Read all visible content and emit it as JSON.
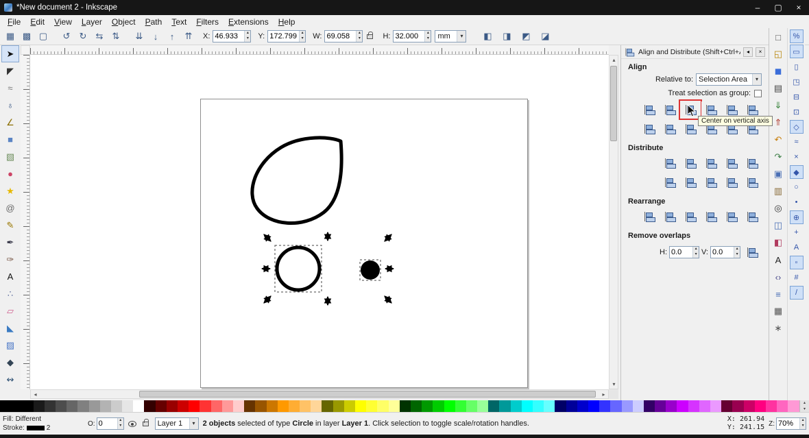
{
  "titlebar": {
    "title": "*New document 2 - Inkscape",
    "minimize": "–",
    "maximize": "▢",
    "close": "×"
  },
  "menubar": {
    "items": [
      {
        "name": "menu-file",
        "label": "File"
      },
      {
        "name": "menu-edit",
        "label": "Edit"
      },
      {
        "name": "menu-view",
        "label": "View"
      },
      {
        "name": "menu-layer",
        "label": "Layer"
      },
      {
        "name": "menu-object",
        "label": "Object"
      },
      {
        "name": "menu-path",
        "label": "Path"
      },
      {
        "name": "menu-text",
        "label": "Text"
      },
      {
        "name": "menu-filters",
        "label": "Filters"
      },
      {
        "name": "menu-extensions",
        "label": "Extensions"
      },
      {
        "name": "menu-help",
        "label": "Help"
      }
    ]
  },
  "toolbar": {
    "left_icons": [
      {
        "name": "select-all-icon",
        "glyph": "▦"
      },
      {
        "name": "select-all-layers-icon",
        "glyph": "▩"
      },
      {
        "name": "deselect-icon",
        "glyph": "▢"
      },
      {
        "name": "separator",
        "glyph": "",
        "sep": true
      },
      {
        "name": "rotate-ccw-icon",
        "glyph": "↺"
      },
      {
        "name": "rotate-cw-icon",
        "glyph": "↻"
      },
      {
        "name": "flip-horizontal-icon",
        "glyph": "⇆"
      },
      {
        "name": "flip-vertical-icon",
        "glyph": "⇅"
      },
      {
        "name": "separator",
        "glyph": "",
        "sep": true
      },
      {
        "name": "lower-to-bottom-icon",
        "glyph": "⇊"
      },
      {
        "name": "lower-icon",
        "glyph": "↓"
      },
      {
        "name": "raise-icon",
        "glyph": "↑"
      },
      {
        "name": "raise-to-top-icon",
        "glyph": "⇈"
      }
    ],
    "x_label": "X:",
    "x_value": "46.933",
    "y_label": "Y:",
    "y_value": "172.799",
    "w_label": "W:",
    "w_value": "69.058",
    "h_label": "H:",
    "h_value": "32.000",
    "units_value": "mm",
    "right_icons": [
      {
        "name": "transform-stroke-toggle-icon",
        "glyph": "◧"
      },
      {
        "name": "transform-corners-toggle-icon",
        "glyph": "◨"
      },
      {
        "name": "transform-gradient-toggle-icon",
        "glyph": "◩"
      },
      {
        "name": "transform-pattern-toggle-icon",
        "glyph": "◪"
      }
    ]
  },
  "toolbox": {
    "tools": [
      {
        "name": "selector-tool",
        "glyph": "➤",
        "color": "#111111",
        "selected": true
      },
      {
        "name": "node-editor-tool",
        "glyph": "◤",
        "color": "#333333"
      },
      {
        "name": "tweak-tool",
        "glyph": "≈",
        "color": "#777777"
      },
      {
        "name": "zoom-tool",
        "glyph": "♁",
        "color": "#2f4f7f"
      },
      {
        "name": "measure-tool",
        "glyph": "∠",
        "color": "#8a6d00"
      },
      {
        "name": "rectangle-tool",
        "glyph": "■",
        "color": "#5b84c4"
      },
      {
        "name": "box3d-tool",
        "glyph": "▧",
        "color": "#6f8f5f"
      },
      {
        "name": "ellipse-tool",
        "glyph": "●",
        "color": "#cc4466"
      },
      {
        "name": "star-tool",
        "glyph": "★",
        "color": "#e6b800"
      },
      {
        "name": "spiral-tool",
        "glyph": "@",
        "color": "#666666"
      },
      {
        "name": "pencil-tool",
        "glyph": "✎",
        "color": "#997700"
      },
      {
        "name": "pen-tool",
        "glyph": "✒",
        "color": "#333344"
      },
      {
        "name": "calligraphy-tool",
        "glyph": "✑",
        "color": "#775544"
      },
      {
        "name": "text-tool",
        "glyph": "A",
        "color": "#111111"
      },
      {
        "name": "spray-tool",
        "glyph": "∴",
        "color": "#556699"
      },
      {
        "name": "eraser-tool",
        "glyph": "▱",
        "color": "#d06090"
      },
      {
        "name": "paint-bucket-tool",
        "glyph": "◣",
        "color": "#3a7ac2"
      },
      {
        "name": "gradient-tool",
        "glyph": "▨",
        "color": "#4d79c7"
      },
      {
        "name": "dropper-tool",
        "glyph": "◆",
        "color": "#334455"
      },
      {
        "name": "connector-tool",
        "glyph": "↭",
        "color": "#335577"
      }
    ]
  },
  "align_panel": {
    "title": "Align and Distribute (Shift+Ctrl+A)",
    "align_header": "Align",
    "relative_to_label": "Relative to:",
    "relative_to_value": "Selection Area",
    "group_label": "Treat selection as group:",
    "align_row1": [
      {
        "name": "align-right-to-left-edge-button"
      },
      {
        "name": "align-left-edges-button"
      },
      {
        "name": "center-on-vertical-axis-button",
        "highlight": true
      },
      {
        "name": "align-right-edges-button"
      },
      {
        "name": "align-left-to-right-edge-button"
      },
      {
        "name": "text-align-horizontal-button"
      }
    ],
    "align_row2": [
      {
        "name": "align-bottom-to-top-edge-button"
      },
      {
        "name": "align-top-edges-button"
      },
      {
        "name": "center-on-horizontal-axis-button"
      },
      {
        "name": "align-bottom-edges-button"
      },
      {
        "name": "align-top-to-bottom-edge-button"
      },
      {
        "name": "text-baseline-button"
      }
    ],
    "distribute_header": "Distribute",
    "distribute_row1": [
      {
        "name": "distribute-left-edges-button"
      },
      {
        "name": "distribute-centers-horizontal-button"
      },
      {
        "name": "distribute-right-edges-button"
      },
      {
        "name": "distribute-equal-horizontal-gaps-button"
      },
      {
        "name": "distribute-text-anchors-horizontal-button"
      }
    ],
    "distribute_row2": [
      {
        "name": "distribute-top-edges-button"
      },
      {
        "name": "distribute-centers-vertical-button"
      },
      {
        "name": "distribute-bottom-edges-button"
      },
      {
        "name": "distribute-equal-vertical-gaps-button"
      },
      {
        "name": "distribute-text-baselines-vertical-button"
      }
    ],
    "rearrange_header": "Rearrange",
    "rearrange_row": [
      {
        "name": "graph-layout-button"
      },
      {
        "name": "exchange-selection-order-button"
      },
      {
        "name": "exchange-stacking-order-button"
      },
      {
        "name": "rotate-positions-button"
      },
      {
        "name": "randomize-centers-button"
      },
      {
        "name": "unclump-button"
      }
    ],
    "remove_header": "Remove overlaps",
    "h_label": "H:",
    "h_value": "0.0",
    "v_label": "V:",
    "v_value": "0.0",
    "tooltip": "Center on vertical axis"
  },
  "commands_bar": {
    "items": [
      {
        "name": "new-document-icon",
        "glyph": "□",
        "color": "#555555"
      },
      {
        "name": "open-document-icon",
        "glyph": "◱",
        "color": "#b8860b"
      },
      {
        "name": "save-icon",
        "glyph": "◼",
        "color": "#3a6dd9"
      },
      {
        "name": "print-icon",
        "glyph": "▤",
        "color": "#444444"
      },
      {
        "name": "import-icon",
        "glyph": "⇓",
        "color": "#2e7d32"
      },
      {
        "name": "export-icon",
        "glyph": "⇑",
        "color": "#b03a2e"
      },
      {
        "name": "undo-icon",
        "glyph": "↶",
        "color": "#c77d0a"
      },
      {
        "name": "redo-icon",
        "glyph": "↷",
        "color": "#3a7d44"
      },
      {
        "name": "copy-icon",
        "glyph": "▣",
        "color": "#4a6fb5"
      },
      {
        "name": "paste-icon",
        "glyph": "▥",
        "color": "#8a6d3b"
      },
      {
        "name": "zoom-drawing-icon",
        "glyph": "◎",
        "color": "#333333"
      },
      {
        "name": "duplicate-icon",
        "glyph": "◫",
        "color": "#4a6fb5"
      },
      {
        "name": "fill-stroke-dialog-icon",
        "glyph": "◧",
        "color": "#b03a5e"
      },
      {
        "name": "text-dialog-icon",
        "glyph": "A",
        "color": "#222222"
      },
      {
        "name": "xml-editor-icon",
        "glyph": "‹›",
        "color": "#4a4a8a"
      },
      {
        "name": "align-dialog-icon",
        "glyph": "≡",
        "color": "#4a6fb5"
      },
      {
        "name": "document-properties-icon",
        "glyph": "▦",
        "color": "#555555"
      },
      {
        "name": "preferences-icon",
        "glyph": "∗",
        "color": "#555555"
      }
    ]
  },
  "snap_bar": {
    "items": [
      {
        "name": "snap-toggle-icon",
        "glyph": "%",
        "active": true
      },
      {
        "name": "snap-bbox-icon",
        "glyph": "▭",
        "active": true
      },
      {
        "name": "snap-bbox-edges-icon",
        "glyph": "▯"
      },
      {
        "name": "snap-bbox-corners-icon",
        "glyph": "◳"
      },
      {
        "name": "snap-bbox-edge-midpoints-icon",
        "glyph": "⊟"
      },
      {
        "name": "snap-bbox-centers-icon",
        "glyph": "⊡"
      },
      {
        "name": "snap-nodes-icon",
        "glyph": "◇",
        "active": true
      },
      {
        "name": "snap-paths-icon",
        "glyph": "≈"
      },
      {
        "name": "snap-path-intersections-icon",
        "glyph": "×"
      },
      {
        "name": "snap-cusp-nodes-icon",
        "glyph": "◆",
        "active": true
      },
      {
        "name": "snap-smooth-nodes-icon",
        "glyph": "○"
      },
      {
        "name": "snap-midpoints-icon",
        "glyph": "•"
      },
      {
        "name": "snap-object-centers-icon",
        "glyph": "⊕",
        "active": true
      },
      {
        "name": "snap-rotation-centers-icon",
        "glyph": "+"
      },
      {
        "name": "snap-text-baseline-icon",
        "glyph": "A"
      },
      {
        "name": "snap-page-border-icon",
        "glyph": "▫",
        "active": true
      },
      {
        "name": "snap-grids-icon",
        "glyph": "#"
      },
      {
        "name": "snap-guides-icon",
        "glyph": "/",
        "active": true
      }
    ]
  },
  "palette": {
    "colors": [
      "#000000",
      "#1a1a1a",
      "#333333",
      "#4d4d4d",
      "#666666",
      "#808080",
      "#999999",
      "#b3b3b3",
      "#cccccc",
      "#e6e6e6",
      "#ffffff",
      "#330000",
      "#660000",
      "#990000",
      "#cc0000",
      "#ff0000",
      "#ff3333",
      "#ff6666",
      "#ff9999",
      "#ffcccc",
      "#663300",
      "#995500",
      "#cc7700",
      "#ff9900",
      "#ffad33",
      "#ffc266",
      "#ffd699",
      "#666600",
      "#999900",
      "#cccc00",
      "#ffff00",
      "#ffff33",
      "#ffff66",
      "#ffff99",
      "#003300",
      "#006600",
      "#009900",
      "#00cc00",
      "#00ff00",
      "#33ff33",
      "#66ff66",
      "#99ff99",
      "#006666",
      "#009999",
      "#00cccc",
      "#00ffff",
      "#33ffff",
      "#66ffff",
      "#000066",
      "#000099",
      "#0000cc",
      "#0000ff",
      "#3333ff",
      "#6666ff",
      "#9999ff",
      "#ccccff",
      "#330066",
      "#660099",
      "#9900cc",
      "#cc00ff",
      "#d633ff",
      "#e066ff",
      "#eb99ff",
      "#660033",
      "#990050",
      "#cc0066",
      "#ff0080",
      "#ff33a0",
      "#ff66c0",
      "#ff99d5"
    ]
  },
  "statusbar": {
    "fill_label": "Fill:",
    "fill_value": "Different",
    "stroke_label": "Stroke:",
    "stroke_width": "2",
    "opacity_label": "O:",
    "opacity_value": "0",
    "layer_name": "Layer 1",
    "message_parts": [
      {
        "text": "2 objects",
        "bold": true
      },
      {
        "text": " selected of type ",
        "bold": false
      },
      {
        "text": "Circle",
        "bold": true
      },
      {
        "text": " in layer ",
        "bold": false
      },
      {
        "text": "Layer 1",
        "bold": true
      },
      {
        "text": ". Click selection to toggle scale/rotation handles.",
        "bold": false
      }
    ],
    "x_label": "X:",
    "x_value": "261.94",
    "y_label": "Y:",
    "y_value": "241.15",
    "zoom_label": "Z:",
    "zoom_value": "70%"
  }
}
